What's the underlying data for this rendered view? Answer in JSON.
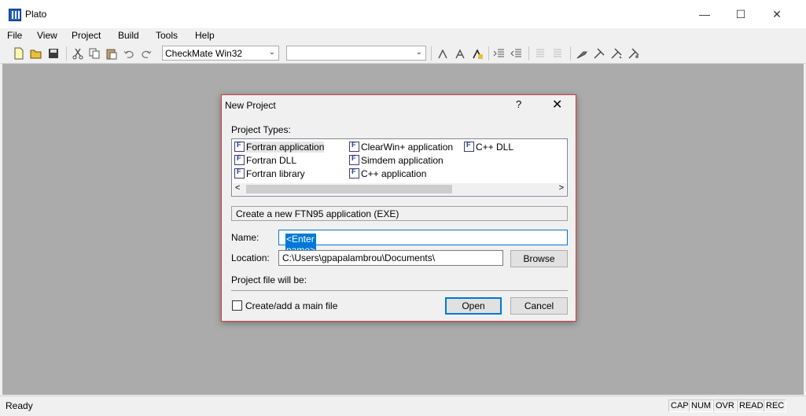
{
  "window": {
    "title": "Plato",
    "minimize": "—",
    "maximize": "☐",
    "close": "✕"
  },
  "menu": [
    "File",
    "View",
    "Project",
    "Build",
    "Tools",
    "Help"
  ],
  "toolbar": {
    "config_combo": "CheckMate Win32",
    "second_combo": ""
  },
  "status": {
    "text": "Ready",
    "indicators": [
      "CAP",
      "NUM",
      "OVR",
      "READ",
      "REC"
    ]
  },
  "dialog": {
    "title": "New Project",
    "help": "?",
    "close": "✕",
    "project_types_label": "Project Types:",
    "project_types": [
      "Fortran application",
      "Fortran DLL",
      "Fortran library",
      "ClearWin+ application",
      "Simdem application",
      "C++ application",
      "C++ DLL"
    ],
    "selected_type": "Fortran application",
    "description": "Create a new FTN95 application (EXE)",
    "name_label": "Name:",
    "name_value": "<Enter name>",
    "location_label": "Location:",
    "location_value": "C:\\Users\\gpapalambrou\\Documents\\",
    "browse_button": "Browse",
    "project_file_label": "Project file will be:",
    "checkbox_label": "Create/add a main file",
    "open_button": "Open",
    "cancel_button": "Cancel"
  }
}
